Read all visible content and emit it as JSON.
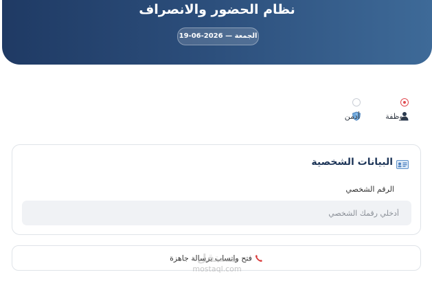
{
  "header": {
    "title": "نظام الحضور والانصراف",
    "date": "الجمعة — 2026-06-19"
  },
  "roles": {
    "employee": {
      "label": "موظفة",
      "icon": "person-icon",
      "selected": true
    },
    "admin": {
      "label": "أدمن",
      "icon": "shield-icon",
      "selected": false
    }
  },
  "personal_info": {
    "title": "البيانات الشخصية",
    "icon": "id-card-icon",
    "id_label": "الرقم الشخصي",
    "id_placeholder": "أدخلي رقمك الشخصي",
    "id_value": ""
  },
  "whatsapp_button": {
    "label": "فتح واتساب برسالة جاهزة",
    "icon": "phone-icon"
  },
  "watermark": {
    "brand": "مستقل",
    "domain": "mostaql.com"
  },
  "colors": {
    "header_start": "#1f3a64",
    "header_end": "#3e6a98",
    "accent_red": "#e0494f",
    "title_navy": "#1d3558"
  }
}
